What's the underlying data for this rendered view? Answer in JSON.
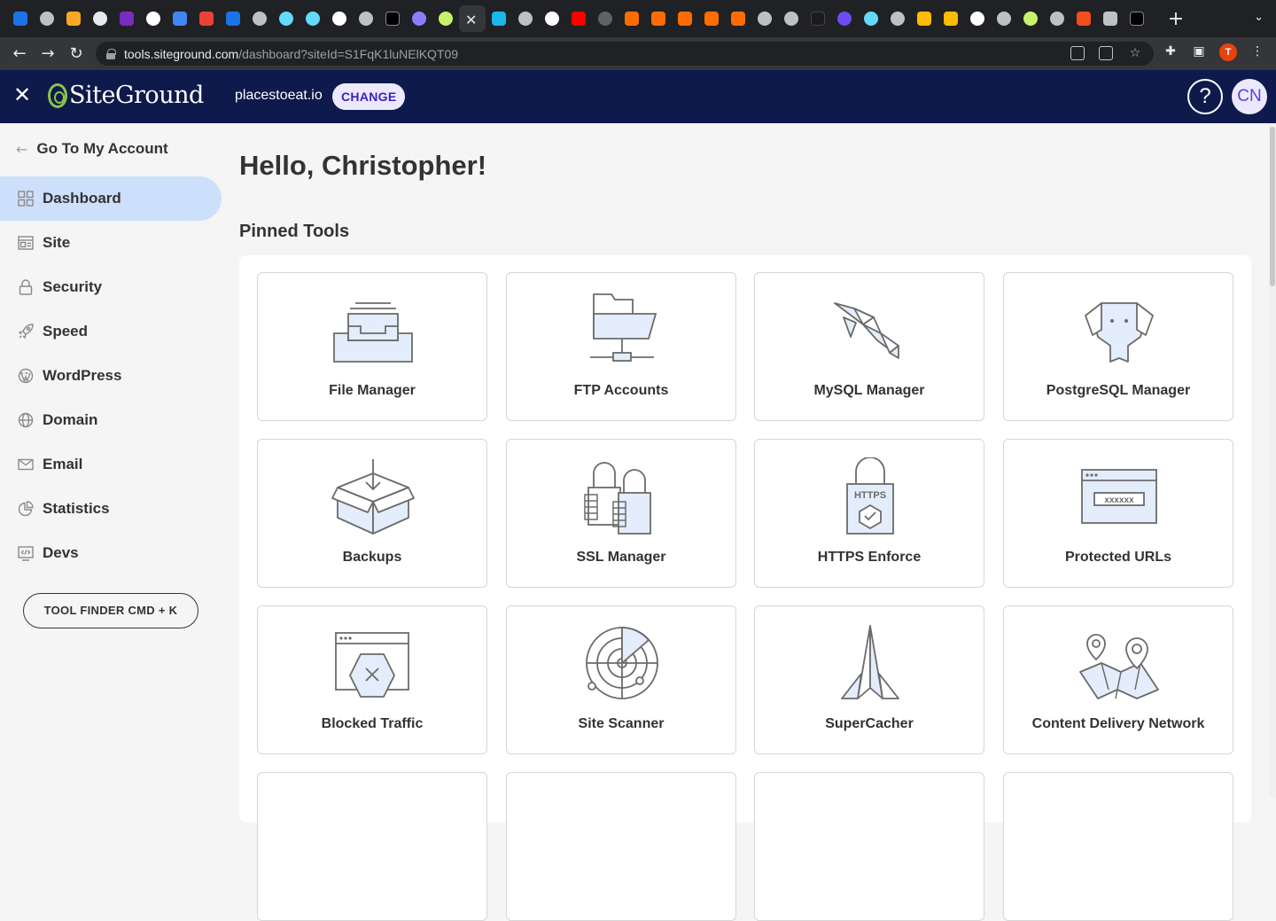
{
  "browser": {
    "url_host": "tools.siteground.com",
    "url_path": "/dashboard?siteId=S1FqK1luNElKQT09",
    "profile_initial": "T"
  },
  "header": {
    "brand": "SiteGround",
    "site": "placestoeat.io",
    "change_label": "CHANGE",
    "help_label": "?",
    "avatar": "CN"
  },
  "sidebar": {
    "back_label": "Go To My Account",
    "items": [
      {
        "label": "Dashboard",
        "icon": "dashboard-icon"
      },
      {
        "label": "Site",
        "icon": "site-icon"
      },
      {
        "label": "Security",
        "icon": "lock-icon"
      },
      {
        "label": "Speed",
        "icon": "rocket-icon"
      },
      {
        "label": "WordPress",
        "icon": "wordpress-icon"
      },
      {
        "label": "Domain",
        "icon": "globe-icon"
      },
      {
        "label": "Email",
        "icon": "envelope-icon"
      },
      {
        "label": "Statistics",
        "icon": "pie-chart-icon"
      },
      {
        "label": "Devs",
        "icon": "code-icon"
      }
    ],
    "tool_finder": "TOOL FINDER CMD + K"
  },
  "main": {
    "greeting": "Hello, Christopher!",
    "pinned_title": "Pinned Tools",
    "tools": [
      {
        "label": "File Manager",
        "icon": "file-manager-icon"
      },
      {
        "label": "FTP Accounts",
        "icon": "ftp-folder-icon"
      },
      {
        "label": "MySQL Manager",
        "icon": "dolphin-icon"
      },
      {
        "label": "PostgreSQL Manager",
        "icon": "elephant-icon"
      },
      {
        "label": "Backups",
        "icon": "box-icon"
      },
      {
        "label": "SSL Manager",
        "icon": "padlocks-icon"
      },
      {
        "label": "HTTPS Enforce",
        "icon": "https-lock-icon"
      },
      {
        "label": "Protected URLs",
        "icon": "password-window-icon"
      },
      {
        "label": "Blocked Traffic",
        "icon": "blocked-window-icon"
      },
      {
        "label": "Site Scanner",
        "icon": "radar-icon"
      },
      {
        "label": "SuperCacher",
        "icon": "paper-rocket-icon"
      },
      {
        "label": "Content Delivery Network",
        "icon": "map-pins-icon"
      }
    ]
  },
  "colors": {
    "header_bg": "#0e1a4b",
    "active_nav": "#cde0fb",
    "accent": "#3a1fbf"
  }
}
